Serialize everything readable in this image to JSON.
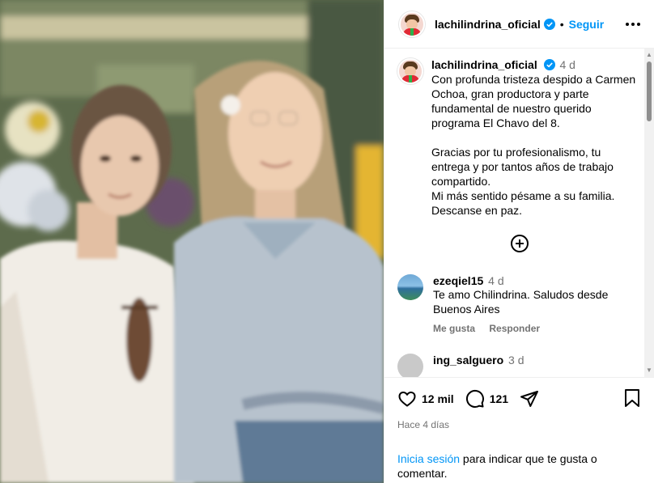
{
  "post": {
    "username": "lachilindrina_oficial",
    "follow_label": "Seguir",
    "separator": "•",
    "caption_time": "4 d",
    "caption": "Con profunda tristeza despido a Carmen Ochoa, gran productora y parte fundamental de nuestro querido programa El Chavo del 8.\n\nGracias por tu profesionalismo, tu entrega y por tantos años de trabajo compartido.\nMi más sentido pésame a su familia.\nDescanse en paz."
  },
  "comments": [
    {
      "user": "ezeqiel15",
      "time": "4 d",
      "text": "Te amo Chilindrina. Saludos desde Buenos Aires",
      "like_label": "Me gusta",
      "reply_label": "Responder"
    },
    {
      "user": "ing_salguero",
      "time": "3 d"
    }
  ],
  "stats": {
    "likes": "12 mil",
    "comments": "121",
    "posted": "Hace 4 días"
  },
  "login": {
    "link": "Inicia sesión",
    "rest": " para indicar que te gusta o comentar."
  },
  "icons": [
    "more-icon",
    "verified-icon",
    "add-circle-icon",
    "heart-icon",
    "comment-icon",
    "share-icon",
    "bookmark-icon"
  ],
  "colors": {
    "accent": "#0095f6",
    "muted": "#737373",
    "verified": "#0095f6"
  }
}
